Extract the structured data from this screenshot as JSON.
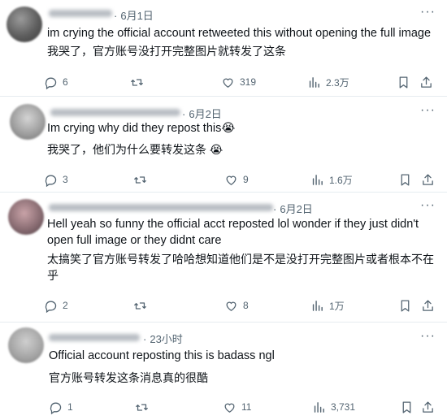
{
  "replies": [
    {
      "date": "6月1日",
      "text_en": "im crying the official account retweeted this without opening the full image",
      "text_cn": "我哭了，官方账号没打开完整图片就转发了这条",
      "replies": "6",
      "likes": "319",
      "views": "2.3万"
    },
    {
      "date": "6月2日",
      "text_en": "Im crying why did they repost this😭",
      "text_cn": "我哭了，他们为什么要转发这条 😭",
      "replies": "3",
      "likes": "9",
      "views": "1.6万"
    },
    {
      "date": "6月2日",
      "text_en": "Hell yeah so funny the official acct reposted lol wonder if they just didn't open full image or they didnt care",
      "text_cn": "太搞笑了官方账号转发了哈哈想知道他们是不是没打开完整图片或者根本不在乎",
      "replies": "2",
      "likes": "8",
      "views": "1万"
    },
    {
      "date": "23小时",
      "text_en": "Official account reposting this is badass ngl",
      "text_cn": "官方账号转发这条消息真的很酷",
      "replies": "1",
      "likes": "11",
      "views": "3,731"
    }
  ],
  "icons": [
    "reply-icon",
    "retweet-icon",
    "like-icon",
    "views-icon",
    "bookmark-icon",
    "share-icon",
    "more-icon"
  ],
  "colors": {
    "text": "#0f1419",
    "secondary": "#536471",
    "divider": "#e6ecf0"
  }
}
